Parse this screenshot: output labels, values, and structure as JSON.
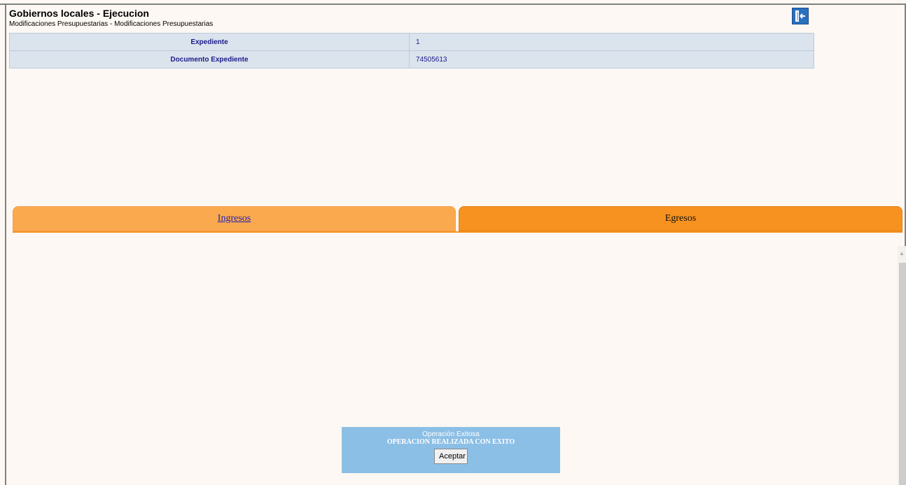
{
  "header": {
    "title": "Gobiernos locales - Ejecucion",
    "subtitle": "Modificaciones Presupuestarias - Modificaciones Presupuestarias"
  },
  "exit_button": {
    "icon": "exit-door-icon"
  },
  "info": {
    "rows": [
      {
        "label": "Expediente",
        "value": "1"
      },
      {
        "label": "Documento Expediente",
        "value": "74505613"
      }
    ]
  },
  "tabs": [
    {
      "label": "Ingresos",
      "active": false
    },
    {
      "label": "Egresos",
      "active": true
    }
  ],
  "dialog": {
    "title": "Operación Exitosa",
    "message": "OPERACION REALIZADA CON EXITO",
    "button": "Aceptar"
  },
  "colors": {
    "tab_inactive": "#fba94e",
    "tab_active": "#f79220",
    "dialog_bg": "#8cbfe6"
  }
}
